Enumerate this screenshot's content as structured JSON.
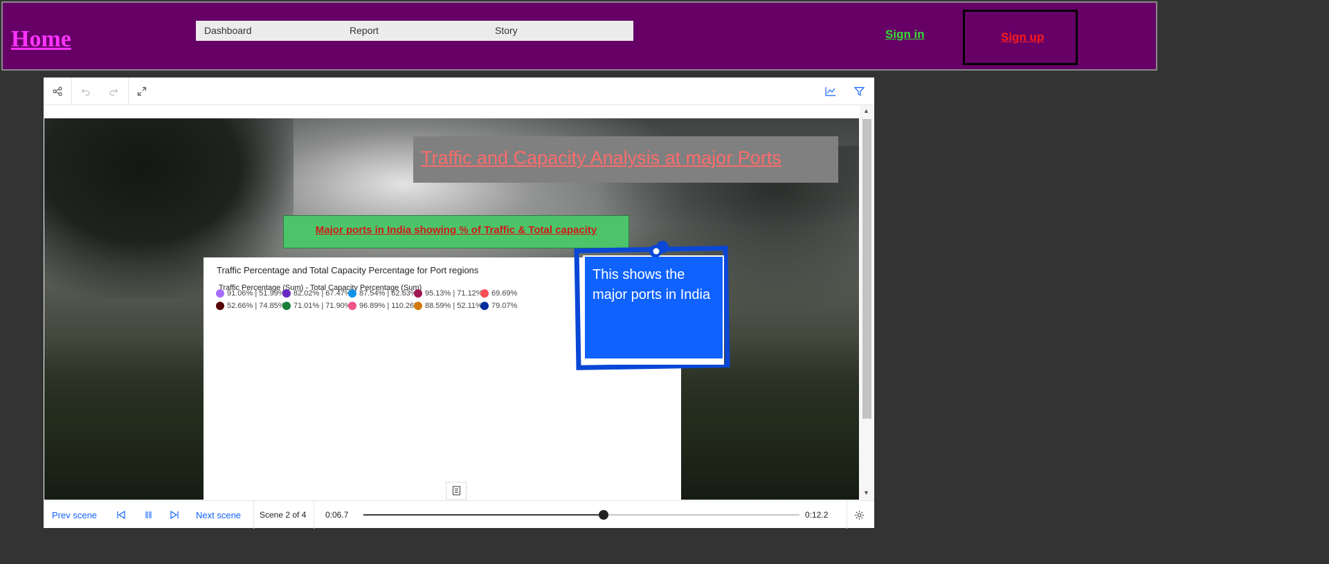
{
  "nav": {
    "home": "Home",
    "menu": [
      "Dashboard",
      "Report",
      "Story"
    ],
    "sign_in": "Sign in",
    "sign_up": "Sign up"
  },
  "story": {
    "title": "Traffic and Capacity Analysis at major Ports",
    "subtitle": "Major ports in India showing % of Traffic & Total capacity",
    "chart": {
      "title": "Traffic Percentage and Total Capacity Percentage for Port regions",
      "legend_title": "Traffic Percentage (Sum) - Total Capacity Percentage (Sum)"
    },
    "note": "This shows the major ports in India"
  },
  "chart_data": {
    "type": "scatter",
    "title": "Traffic Percentage and Total Capacity Percentage for Port regions",
    "legend_title": "Traffic Percentage (Sum) - Total Capacity Percentage (Sum)",
    "series": [
      {
        "name": "91.06% | 51.99%",
        "color": "#a56eff"
      },
      {
        "name": "82.02% | 67.47%",
        "color": "#6929c4"
      },
      {
        "name": "87.54% | 62.63%",
        "color": "#1192e8"
      },
      {
        "name": "95.13% | 71.12%",
        "color": "#9f1853"
      },
      {
        "name": "69.69%",
        "color": "#fa4d56"
      },
      {
        "name": "52.66% | 74.85%",
        "color": "#570408"
      },
      {
        "name": "71.01% | 71.90%",
        "color": "#198038"
      },
      {
        "name": "96.89% | 110.26%",
        "color": "#ee538b"
      },
      {
        "name": "88.59% | 52.11%",
        "color": "#d2790b"
      },
      {
        "name": "79.07%",
        "color": "#002d9c"
      }
    ]
  },
  "controls": {
    "prev": "Prev scene",
    "next": "Next scene",
    "scene": "Scene 2 of 4",
    "elapsed": "0:06.7",
    "total": "0:12.2",
    "progress": 0.55
  },
  "colors": {
    "nav_bg": "#660066",
    "accent": "#0f62fe",
    "title_text": "#ff6b6b",
    "subtitle_bg": "#4cc46a"
  }
}
